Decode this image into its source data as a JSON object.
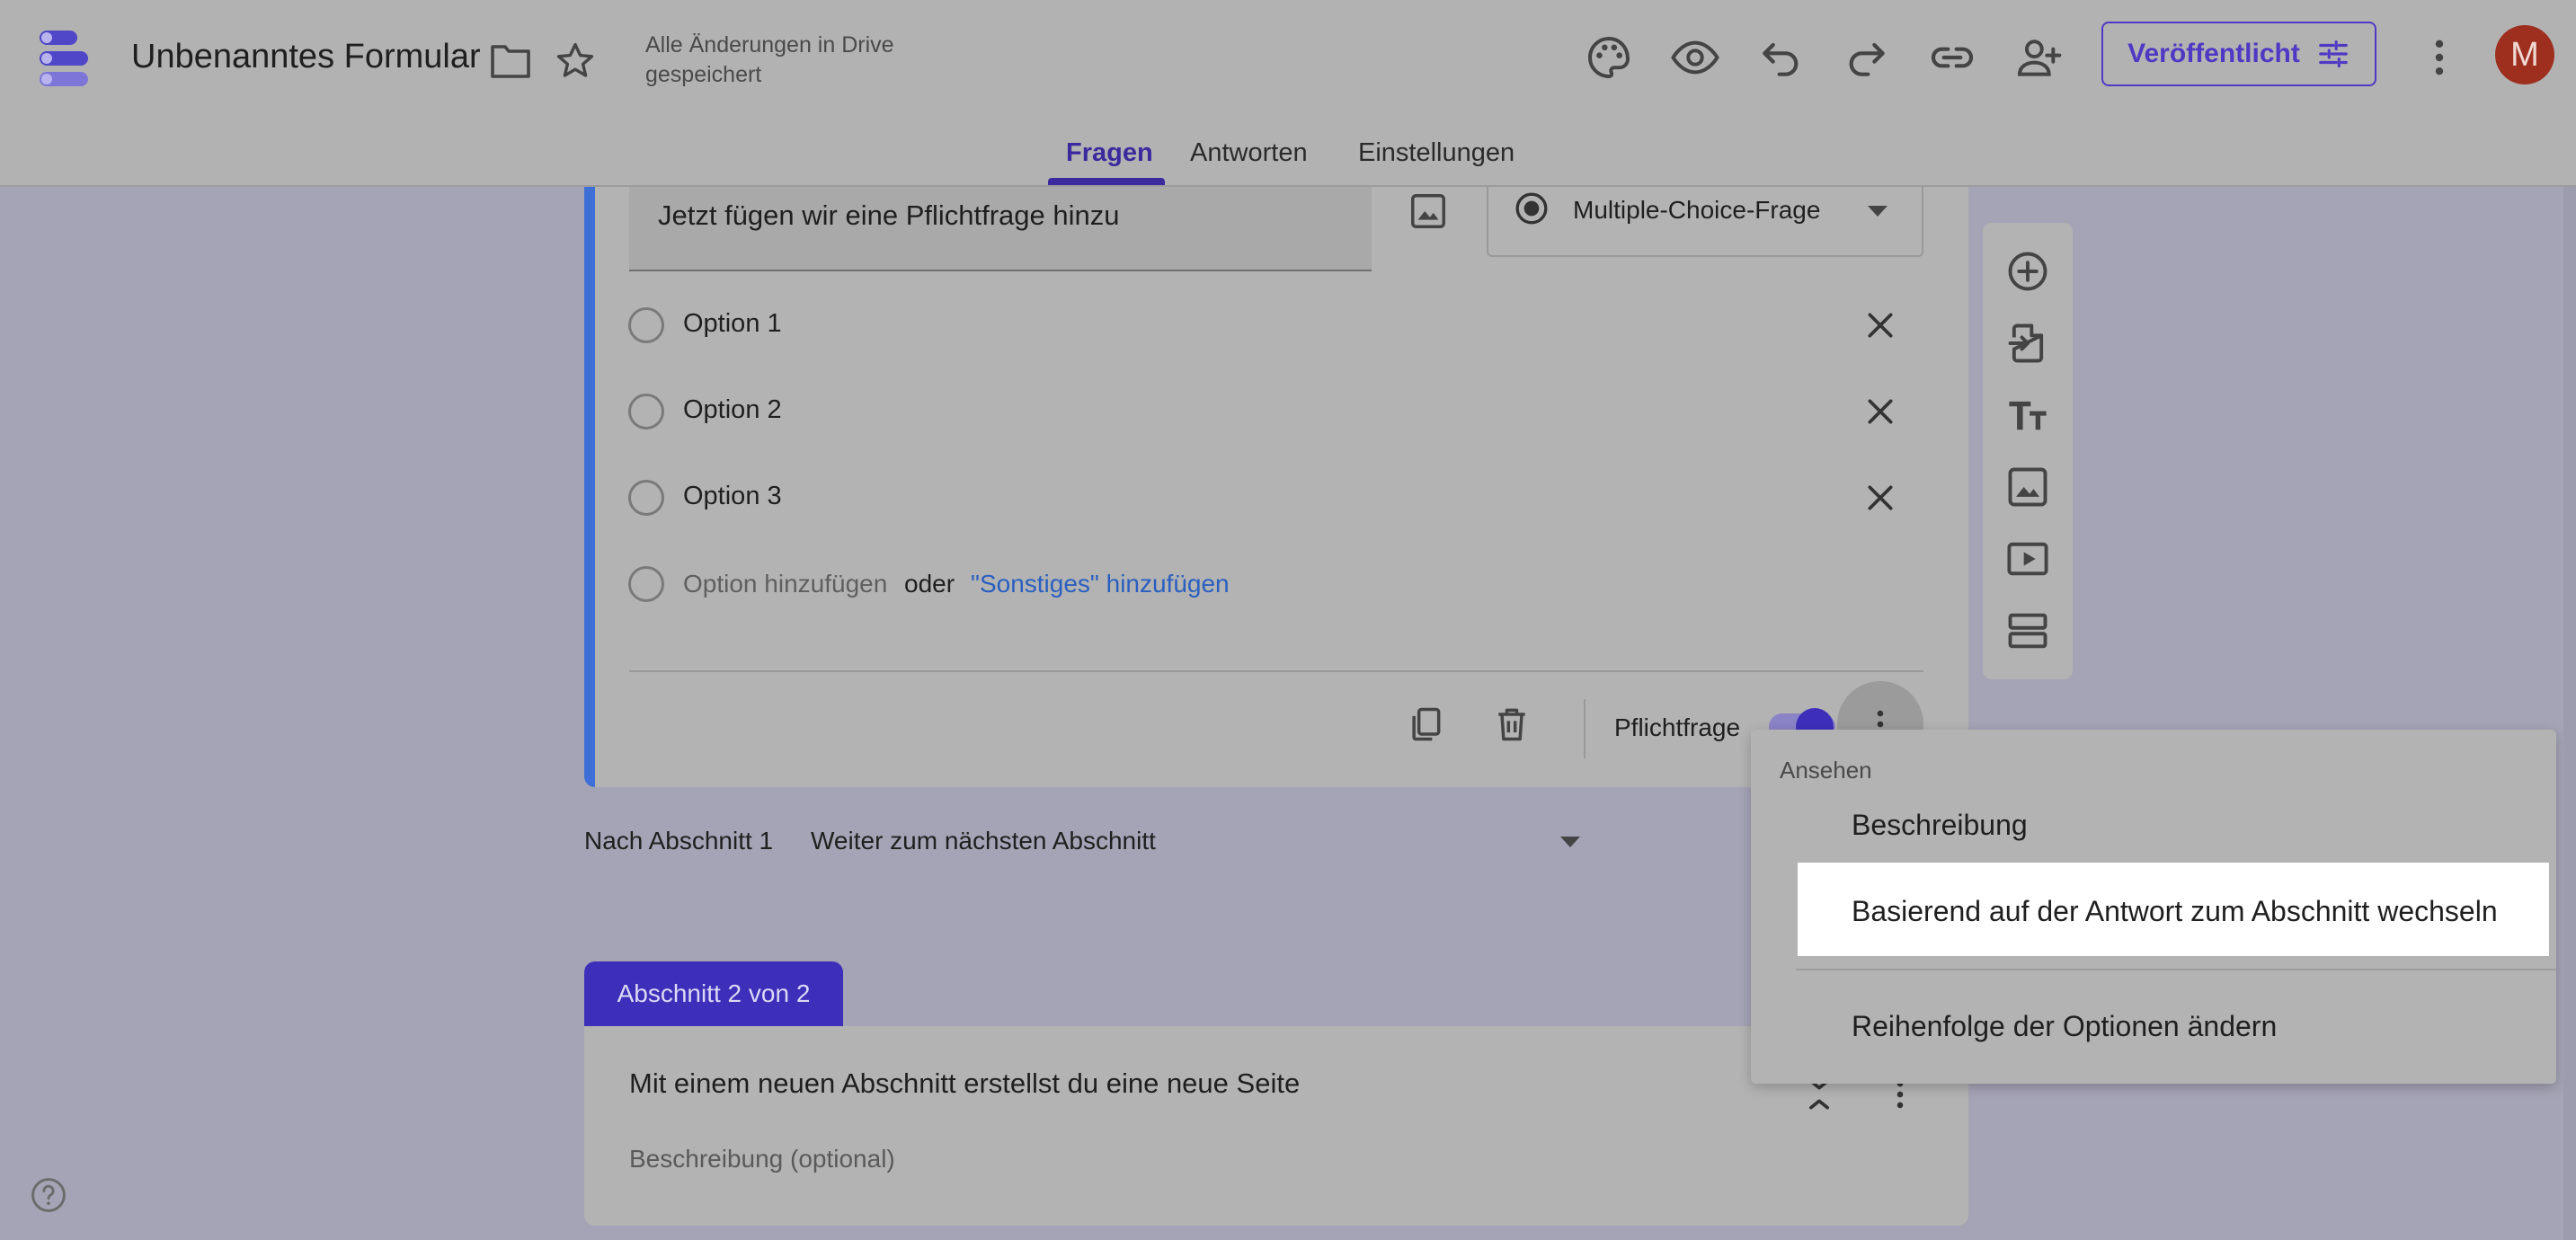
{
  "header": {
    "title": "Unbenanntes Formular",
    "save_status": "Alle Änderungen in Drive gespeichert",
    "publish_label": "Veröffentlicht",
    "avatar_initial": "M",
    "accent_color": "#4f39c4"
  },
  "tabs": [
    {
      "label": "Fragen",
      "active": true
    },
    {
      "label": "Antworten",
      "active": false
    },
    {
      "label": "Einstellungen",
      "active": false
    }
  ],
  "question": {
    "title": "Jetzt fügen wir eine Pflichtfrage hinzu",
    "type_label": "Multiple-Choice-Frage",
    "options": [
      {
        "label": "Option 1"
      },
      {
        "label": "Option 2"
      },
      {
        "label": "Option 3"
      }
    ],
    "add_option_label": "Option hinzufügen",
    "or_label": "oder",
    "add_other_label": "\"Sonstiges\" hinzufügen",
    "required_label": "Pflichtfrage",
    "required": true,
    "accent_color": "#3d6fd6"
  },
  "after_section": {
    "label": "Nach Abschnitt 1",
    "value": "Weiter zum nächsten Abschnitt"
  },
  "section2": {
    "badge": "Abschnitt 2 von 2",
    "title": "Mit einem neuen Abschnitt erstellst du eine neue Seite",
    "description_placeholder": "Beschreibung (optional)"
  },
  "side_toolbar": {
    "items": [
      "add-question-icon",
      "import-questions-icon",
      "add-title-icon",
      "add-image-icon",
      "add-video-icon",
      "add-section-icon"
    ]
  },
  "context_menu": {
    "heading": "Ansehen",
    "items": [
      {
        "label": "Beschreibung",
        "highlighted": false
      },
      {
        "label": "Basierend auf der Antwort zum Abschnitt wechseln",
        "highlighted": true
      },
      {
        "label": "Reihenfolge der Optionen ändern",
        "highlighted": false
      }
    ]
  }
}
